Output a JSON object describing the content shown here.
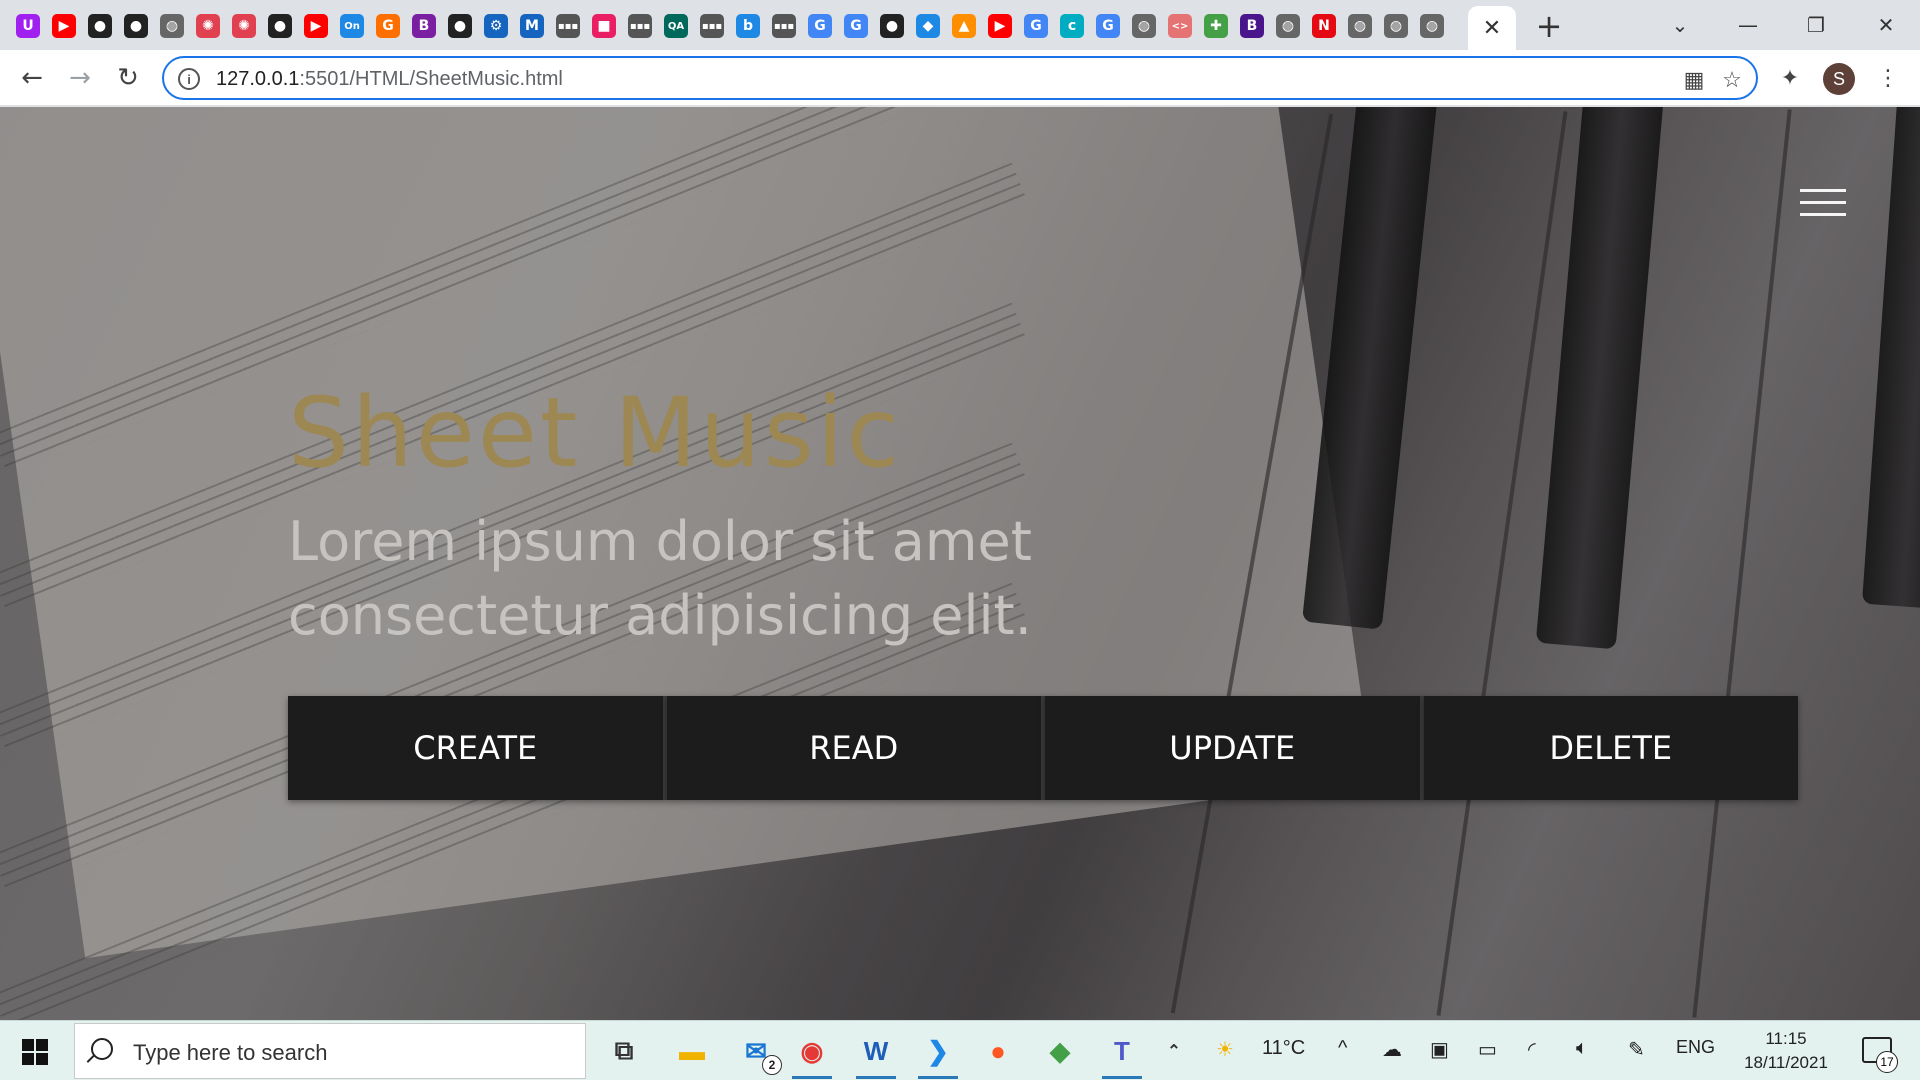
{
  "browser": {
    "url_host": "127.0.0.1",
    "url_path": ":5501/HTML/SheetMusic.html",
    "profile_initial": "S",
    "tab_favicons": [
      {
        "name": "uipath-icon",
        "glyph": "U",
        "color": "#a020f0"
      },
      {
        "name": "youtube-icon",
        "glyph": "▶",
        "color": "#ff0000"
      },
      {
        "name": "github-icon",
        "glyph": "●",
        "color": "#222222"
      },
      {
        "name": "github-icon",
        "glyph": "●",
        "color": "#222222"
      },
      {
        "name": "globe-icon",
        "glyph": "◍",
        "color": "#666666"
      },
      {
        "name": "openai-icon",
        "glyph": "✺",
        "color": "#e04050"
      },
      {
        "name": "openai-icon",
        "glyph": "✺",
        "color": "#e04050"
      },
      {
        "name": "github-icon",
        "glyph": "●",
        "color": "#222222"
      },
      {
        "name": "youtube-icon",
        "glyph": "▶",
        "color": "#ff0000"
      },
      {
        "name": "on-icon",
        "glyph": "On",
        "color": "#1e88e5"
      },
      {
        "name": "g-orange-icon",
        "glyph": "G",
        "color": "#ff6f00"
      },
      {
        "name": "b-purple-icon",
        "glyph": "B",
        "color": "#7b1fa2"
      },
      {
        "name": "github-icon",
        "glyph": "●",
        "color": "#222222"
      },
      {
        "name": "gear-icon",
        "glyph": "⚙",
        "color": "#1565c0"
      },
      {
        "name": "mdn-icon",
        "glyph": "M",
        "color": "#1565c0"
      },
      {
        "name": "ellipsis-icon",
        "glyph": "▪▪▪",
        "color": "#555555"
      },
      {
        "name": "pink-square-icon",
        "glyph": "■",
        "color": "#e91e63"
      },
      {
        "name": "ellipsis-icon",
        "glyph": "▪▪▪",
        "color": "#555555"
      },
      {
        "name": "qa-icon",
        "glyph": "QA",
        "color": "#00695c"
      },
      {
        "name": "ellipsis-icon",
        "glyph": "▪▪▪",
        "color": "#555555"
      },
      {
        "name": "bing-icon",
        "glyph": "b",
        "color": "#1e88e5"
      },
      {
        "name": "ellipsis-icon",
        "glyph": "▪▪▪",
        "color": "#555555"
      },
      {
        "name": "google-icon",
        "glyph": "G",
        "color": "#4285f4"
      },
      {
        "name": "google-icon",
        "glyph": "G",
        "color": "#4285f4"
      },
      {
        "name": "github-icon",
        "glyph": "●",
        "color": "#222222"
      },
      {
        "name": "diamond-icon",
        "glyph": "◆",
        "color": "#1e88e5"
      },
      {
        "name": "grid-icon",
        "glyph": "▲",
        "color": "#ff8f00"
      },
      {
        "name": "youtube-icon",
        "glyph": "▶",
        "color": "#ff0000"
      },
      {
        "name": "google-icon",
        "glyph": "G",
        "color": "#4285f4"
      },
      {
        "name": "c-icon",
        "glyph": "c",
        "color": "#00acc1"
      },
      {
        "name": "google-icon",
        "glyph": "G",
        "color": "#4285f4"
      },
      {
        "name": "globe-icon",
        "glyph": "◍",
        "color": "#666666"
      },
      {
        "name": "code-icon",
        "glyph": "<>",
        "color": "#e57373"
      },
      {
        "name": "apps-icon",
        "glyph": "✚",
        "color": "#43a047"
      },
      {
        "name": "b-dark-icon",
        "glyph": "B",
        "color": "#4a148c"
      },
      {
        "name": "globe-icon",
        "glyph": "◍",
        "color": "#666666"
      },
      {
        "name": "netflix-icon",
        "glyph": "N",
        "color": "#e50914"
      },
      {
        "name": "globe-icon",
        "glyph": "◍",
        "color": "#666666"
      },
      {
        "name": "globe-icon",
        "glyph": "◍",
        "color": "#666666"
      },
      {
        "name": "globe-icon",
        "glyph": "◍",
        "color": "#666666"
      }
    ]
  },
  "page": {
    "title": "Sheet Music",
    "subtitle": "Lorem ipsum dolor sit amet consectetur adipisicing elit.",
    "buttons": [
      "CREATE",
      "READ",
      "UPDATE",
      "DELETE"
    ],
    "title_color": "#9d8752"
  },
  "taskbar": {
    "search_placeholder": "Type here to search",
    "mail_badge": "2",
    "weather": "11°C",
    "language": "ENG",
    "time": "11:15",
    "date": "18/11/2021",
    "notifications": "17"
  }
}
